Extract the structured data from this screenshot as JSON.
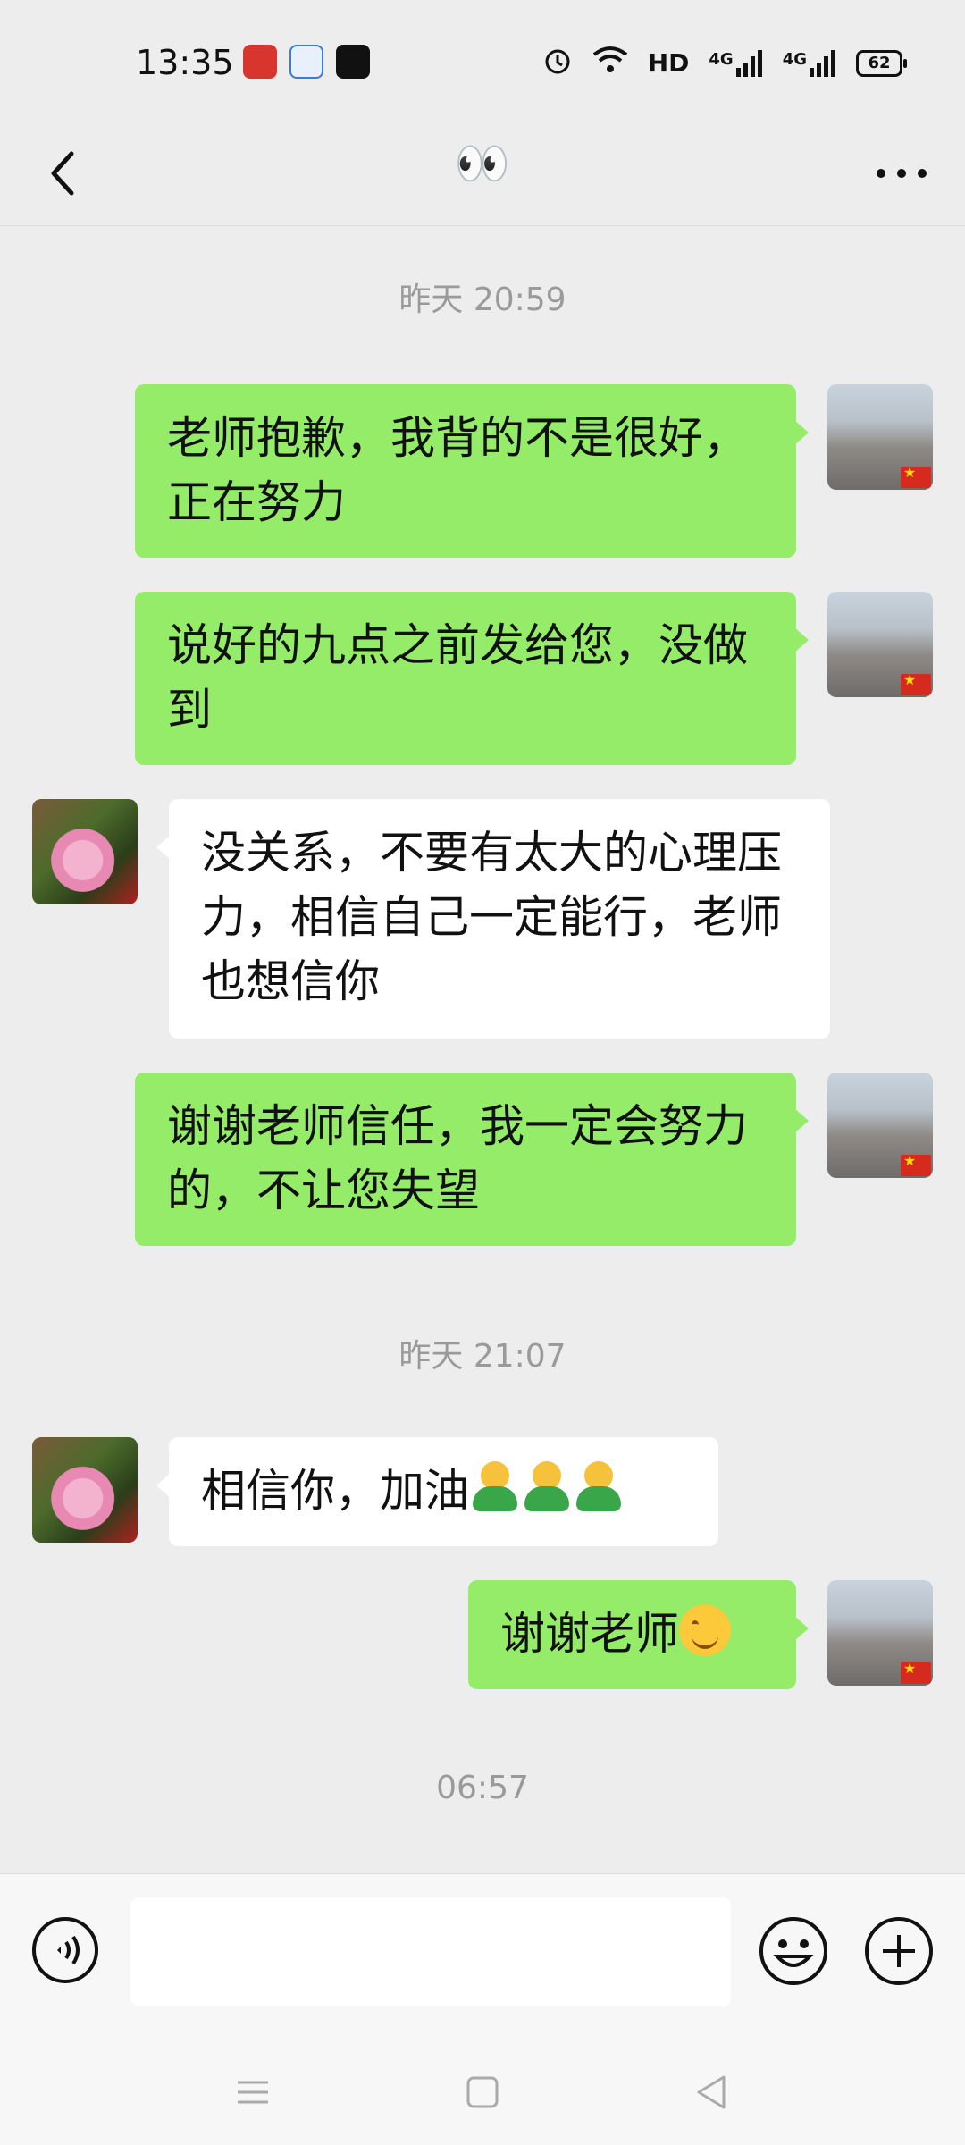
{
  "status_bar": {
    "time": "13:35",
    "hd_label": "HD",
    "signal1_label": "4G",
    "signal2_label": "4G",
    "battery": "62"
  },
  "nav": {
    "title": "👀"
  },
  "timestamps": [
    "昨天 20:59",
    "昨天 21:07",
    "06:57"
  ],
  "messages": [
    {
      "sender": "me",
      "text": "老师抱歉，我背的不是很好，正在努力"
    },
    {
      "sender": "me",
      "text": "说好的九点之前发给您，没做到"
    },
    {
      "sender": "teacher",
      "text": "没关系，不要有太大的心理压力，相信自己一定能行，老师也想信你"
    },
    {
      "sender": "me",
      "text": "谢谢老师信任，我一定会努力的，不让您失望"
    },
    {
      "sender": "teacher",
      "text": "相信你，加油",
      "emoji": "person-green-shirt x3"
    },
    {
      "sender": "me",
      "text": "谢谢老师",
      "emoji": "smiling-face"
    }
  ],
  "input_bar": {
    "placeholder": "",
    "icons": [
      "voice-icon",
      "emoji-icon",
      "plus-icon"
    ]
  },
  "colors": {
    "bubble_me": "#95ec69",
    "bubble_other": "#ffffff",
    "background": "#ededed"
  }
}
